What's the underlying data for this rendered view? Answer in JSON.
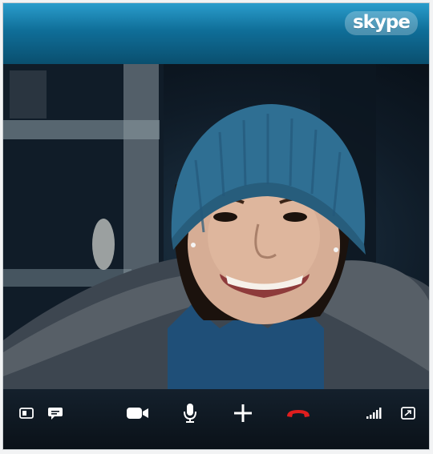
{
  "app": {
    "logo_text": "skype"
  },
  "controls": [
    {
      "name": "show-contacts-button",
      "icon": "contacts-panel-icon"
    },
    {
      "name": "chat-button",
      "icon": "chat-bubble-icon"
    },
    {
      "name": "video-button",
      "icon": "video-camera-icon"
    },
    {
      "name": "mute-button",
      "icon": "microphone-icon"
    },
    {
      "name": "add-button",
      "icon": "plus-icon"
    },
    {
      "name": "end-call-button",
      "icon": "hang-up-icon"
    },
    {
      "name": "call-quality-indicator",
      "icon": "signal-bars-icon"
    },
    {
      "name": "fullscreen-button",
      "icon": "fullscreen-icon"
    }
  ],
  "colors": {
    "header_top": "#2a9dcc",
    "header_bottom": "#0a4f6f",
    "end_call": "#e01e1e",
    "control_bar": "#0e1822",
    "hat_blue": "#2f6f93"
  }
}
